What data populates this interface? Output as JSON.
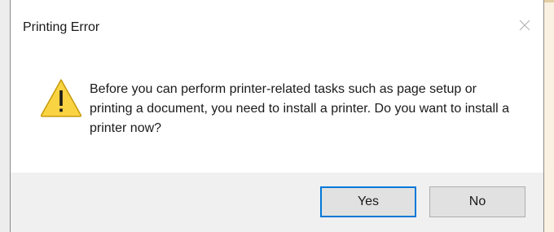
{
  "dialog": {
    "title": "Printing Error",
    "message": "Before you can perform printer-related tasks such as page setup or printing a document, you need to install a printer. Do you want to install a printer now?",
    "icon": "warning-icon",
    "close_icon": "close-icon",
    "buttons": {
      "yes_label": "Yes",
      "no_label": "No",
      "default": "yes"
    }
  },
  "colors": {
    "default_button_border": "#0078d7",
    "warning_fill": "#f9d342",
    "warning_outline": "#c79a0b"
  }
}
